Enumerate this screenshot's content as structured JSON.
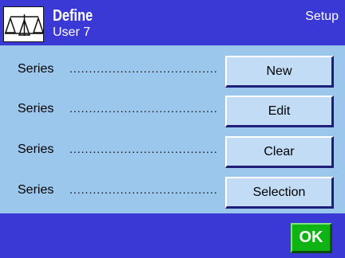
{
  "header": {
    "title": "Define",
    "subtitle": "User 7",
    "section": "Setup",
    "icon": "balance-scale-icon"
  },
  "rows": [
    {
      "label": "Series",
      "dots": "......................................................",
      "button": "New"
    },
    {
      "label": "Series",
      "dots": "......................................................",
      "button": "Edit"
    },
    {
      "label": "Series",
      "dots": "......................................................",
      "button": "Clear"
    },
    {
      "label": "Series",
      "dots": "......................................................",
      "button": "Selection"
    }
  ],
  "footer": {
    "ok_label": "OK"
  },
  "colors": {
    "header_bg": "#3b39d6",
    "panel_bg": "#9cc7ec",
    "button_bg": "#c1dcf4",
    "ok_bg": "#0fb414"
  }
}
